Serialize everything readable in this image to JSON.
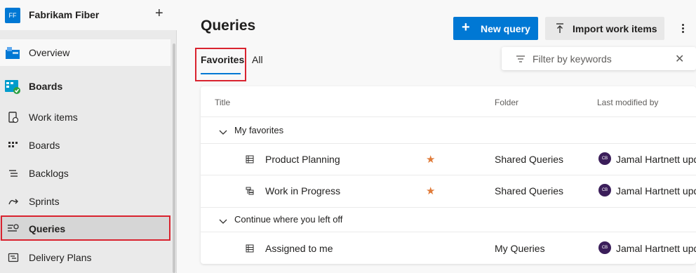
{
  "org": {
    "initials": "FF",
    "name": "Fabrikam Fiber",
    "add": "+"
  },
  "nav": {
    "overview": "Overview",
    "boards_hub": "Boards",
    "work_items": "Work items",
    "boards": "Boards",
    "backlogs": "Backlogs",
    "sprints": "Sprints",
    "queries": "Queries",
    "delivery_plans": "Delivery Plans"
  },
  "page": {
    "title": "Queries",
    "new_query": "New query",
    "import_work_items": "Import work items",
    "tabs": {
      "favorites": "Favorites",
      "all": "All"
    },
    "filter_placeholder": "Filter by keywords"
  },
  "table": {
    "columns": {
      "title": "Title",
      "folder": "Folder",
      "last_modified_by": "Last modified by"
    },
    "groups": [
      {
        "label": "My favorites",
        "rows": [
          {
            "title": "Product Planning",
            "folder": "Shared Queries",
            "user_initials": "CB",
            "user": "Jamal Hartnett upd",
            "icon": "flat-query-icon",
            "favorite": true
          },
          {
            "title": "Work in Progress",
            "folder": "Shared Queries",
            "user_initials": "CB",
            "user": "Jamal Hartnett upd",
            "icon": "tree-query-icon",
            "favorite": true
          }
        ]
      },
      {
        "label": "Continue where you left off",
        "rows": [
          {
            "title": "Assigned to me",
            "folder": "My Queries",
            "user_initials": "CB",
            "user": "Jamal Hartnett upd",
            "icon": "flat-query-icon",
            "favorite": false
          }
        ]
      }
    ]
  },
  "colors": {
    "accent": "#0078d4",
    "star": "#e07b39",
    "highlight": "#d9232f"
  }
}
